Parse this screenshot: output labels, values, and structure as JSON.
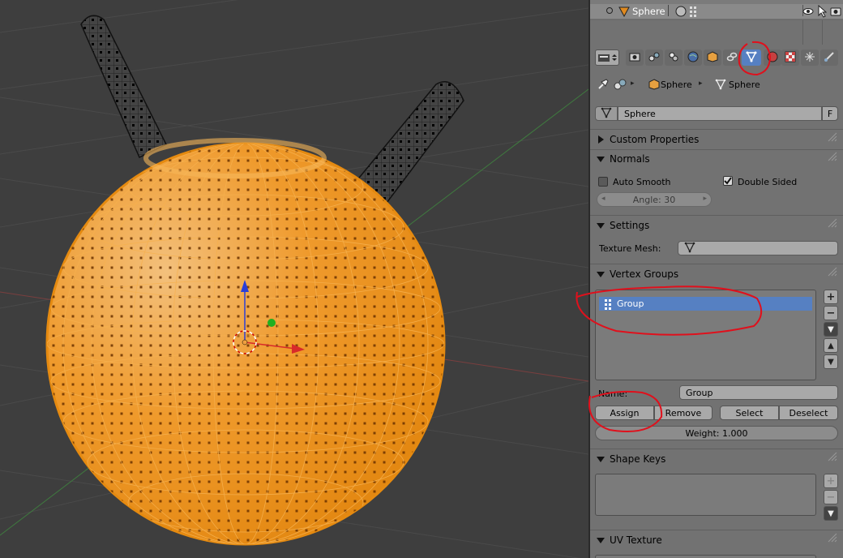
{
  "outliner": {
    "object_name": "Sphere"
  },
  "properties": {
    "breadcrumb": {
      "object": "Sphere",
      "mesh": "Sphere"
    },
    "datablock": {
      "name": "Sphere",
      "fake_user": "F"
    },
    "panels": {
      "custom_properties": "Custom Properties",
      "normals": {
        "title": "Normals",
        "auto_smooth": "Auto Smooth",
        "double_sided": "Double Sided",
        "angle": "Angle: 30"
      },
      "settings": {
        "title": "Settings",
        "texture_mesh_label": "Texture Mesh:"
      },
      "vertex_groups": {
        "title": "Vertex Groups",
        "items": [
          "Group"
        ],
        "name_label": "Name:",
        "name_value": "Group",
        "assign": "Assign",
        "remove": "Remove",
        "select": "Select",
        "deselect": "Deselect",
        "weight": "Weight: 1.000"
      },
      "shape_keys": "Shape Keys",
      "uv_texture": "UV Texture"
    }
  },
  "colors": {
    "selection": "#5680c2",
    "mesh_orange": "#f0a040",
    "annotation_red": "#e0101c"
  }
}
